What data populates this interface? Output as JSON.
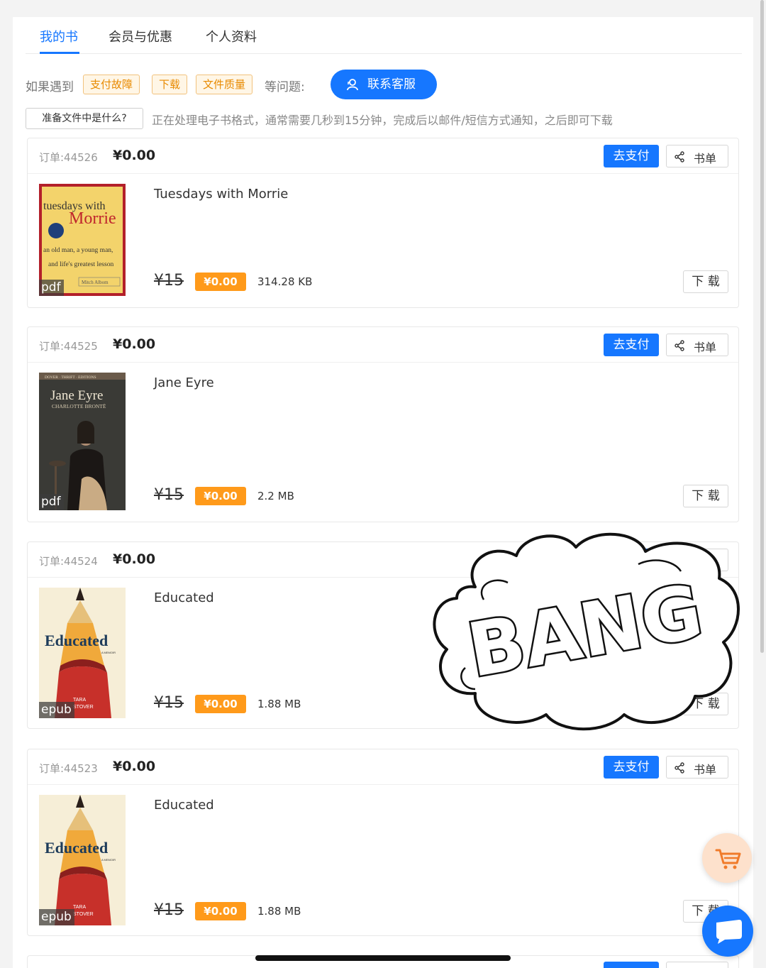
{
  "tabs": [
    {
      "label": "我的书",
      "active": true
    },
    {
      "label": "会员与优惠",
      "active": false
    },
    {
      "label": "个人资料",
      "active": false
    }
  ],
  "notice": {
    "prefix": "如果遇到",
    "tags": [
      "支付故障",
      "下载",
      "文件质量"
    ],
    "suffix": "等问题:",
    "contact_label": "联系客服"
  },
  "prep": {
    "button_label": "准备文件中是什么?",
    "text": "正在处理电子书格式，通常需要几秒到15分钟，完成后以邮件/短信方式通知，之后即可下载"
  },
  "actions": {
    "pay_label": "去支付",
    "booklist_label": "书单",
    "download_label": "下 载"
  },
  "orders": [
    {
      "id": "订单:44526",
      "total": "¥0.00",
      "title": "Tuesdays with Morrie",
      "format": "pdf",
      "orig_price": "¥15",
      "sale_price": "¥0.00",
      "size": "314.28 KB",
      "cover": {
        "line1": "tuesdays with",
        "line2": "Morrie",
        "line3": "an old man, a young man,",
        "line4": "and life's greatest lesson",
        "author": "Mitch Albom"
      }
    },
    {
      "id": "订单:44525",
      "total": "¥0.00",
      "title": "Jane Eyre",
      "format": "pdf",
      "orig_price": "¥15",
      "sale_price": "¥0.00",
      "size": "2.2 MB",
      "cover": {
        "series": "DOVER · THRIFT · EDITIONS",
        "line1": "Jane Eyre",
        "author": "CHARLOTTE BRONTË"
      }
    },
    {
      "id": "订单:44524",
      "total": "¥0.00",
      "title": "Educated",
      "format": "epub",
      "orig_price": "¥15",
      "sale_price": "¥0.00",
      "size": "1.88 MB",
      "cover": {
        "line1": "Educated",
        "sub": "A MEMOIR",
        "author1": "TARA",
        "author2": "STOVER"
      }
    },
    {
      "id": "订单:44523",
      "total": "¥0.00",
      "title": "Educated",
      "format": "epub",
      "orig_price": "¥15",
      "sale_price": "¥0.00",
      "size": "1.88 MB",
      "cover": {
        "line1": "Educated",
        "sub": "A MEMOIR",
        "author1": "TARA",
        "author2": "STOVER"
      }
    }
  ],
  "sticker": {
    "text": "BANG"
  },
  "colors": {
    "primary": "#1677ff",
    "accent": "#ff9a1a",
    "tag_border": "#f2c27d"
  },
  "icons": [
    "user-service-icon",
    "share-icon",
    "cart-icon",
    "chat-icon"
  ]
}
